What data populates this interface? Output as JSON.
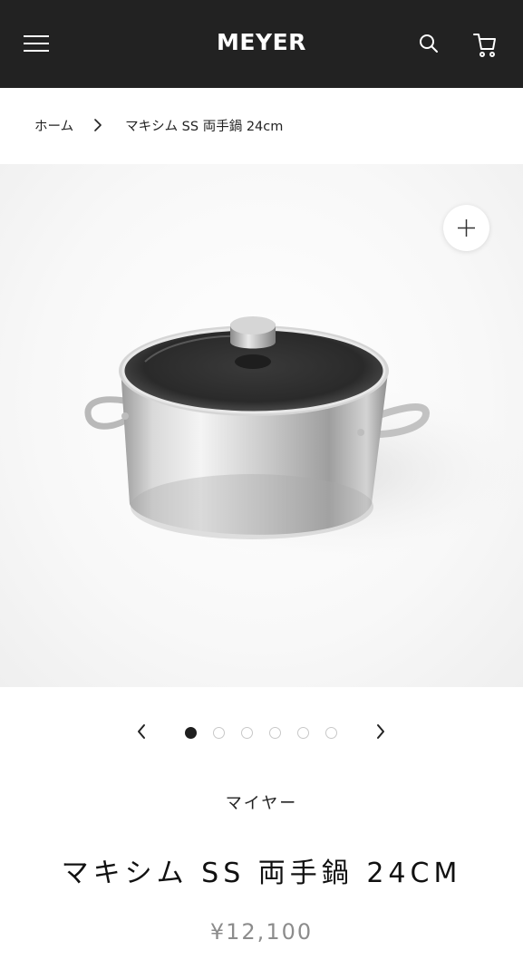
{
  "header": {
    "logo": "MEYER",
    "menu_icon": "hamburger-menu-icon",
    "search_icon": "search-icon",
    "cart_icon": "cart-icon"
  },
  "breadcrumb": {
    "home": "ホーム",
    "separator_icon": "chevron-right-icon",
    "current": "マキシム SS 両手鍋 24cm"
  },
  "gallery": {
    "image": "stainless-steel-stockpot-with-glass-lid",
    "zoom_icon": "plus-icon",
    "total_images": 6,
    "active_index": 1,
    "prev_icon": "chevron-left-icon",
    "next_icon": "chevron-right-icon"
  },
  "product": {
    "brand": "マイヤー",
    "title": "マキシム SS 両手鍋 24CM",
    "price": "¥12,100"
  },
  "colors": {
    "header_bg": "#222222",
    "text": "#1b1b1b",
    "price": "#8c8c8c",
    "dot_active": "#1f1f1f"
  }
}
